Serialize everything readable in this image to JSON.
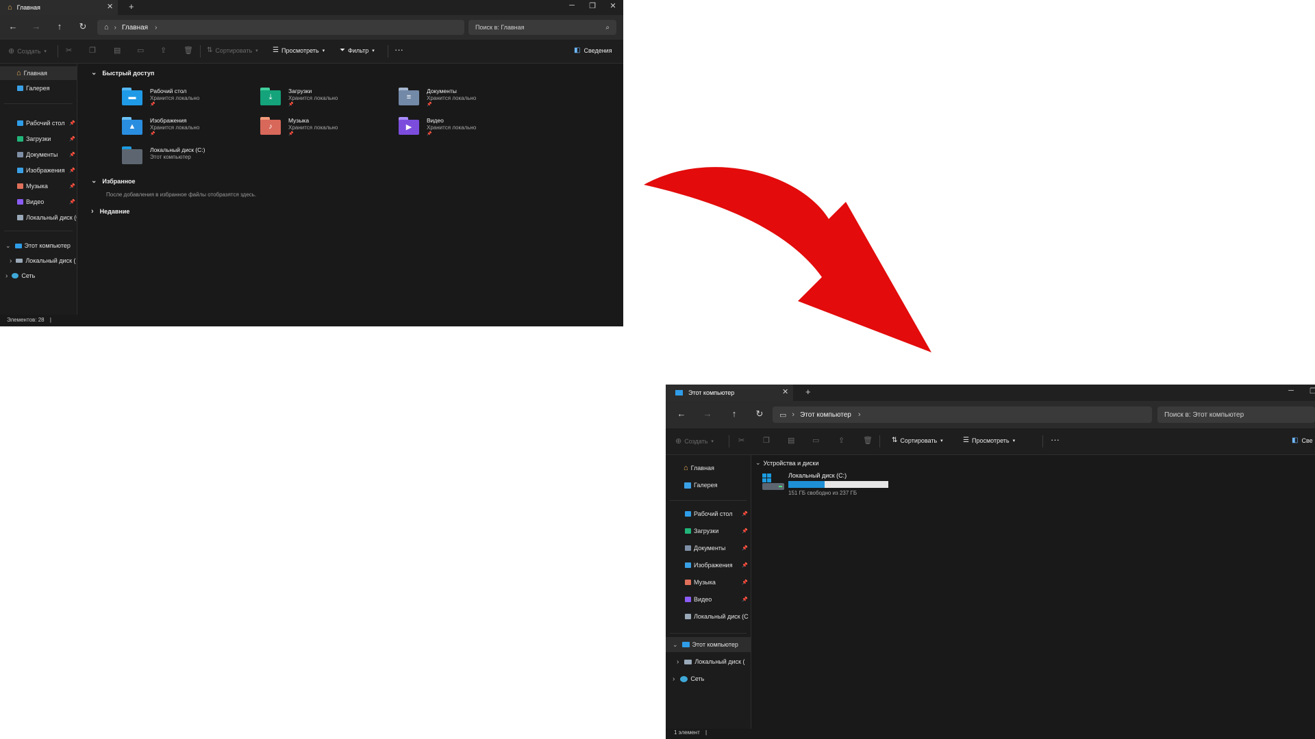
{
  "colors": {
    "accent": "#1e90d6",
    "arrow": "#e30b0b",
    "window_bg": "#191919",
    "sidebar_selected": "#2d2d2d"
  },
  "window1": {
    "tab_title": "Главная",
    "address": "Главная",
    "search_placeholder": "Поиск в: Главная",
    "toolbar": {
      "create": "Создать",
      "sort": "Сортировать",
      "view": "Просмотреть",
      "filter": "Фильтр",
      "details": "Сведения"
    },
    "sidebar": {
      "home": "Главная",
      "gallery": "Галерея",
      "pinned": [
        {
          "label": "Рабочий стол",
          "icon": "desktop-icon"
        },
        {
          "label": "Загрузки",
          "icon": "downloads-icon"
        },
        {
          "label": "Документы",
          "icon": "documents-icon"
        },
        {
          "label": "Изображения",
          "icon": "pictures-icon"
        },
        {
          "label": "Музыка",
          "icon": "music-icon"
        },
        {
          "label": "Видео",
          "icon": "videos-icon"
        },
        {
          "label": "Локальный диск (С",
          "icon": "drive-icon"
        }
      ],
      "this_pc": "Этот компьютер",
      "local_disk": "Локальный диск (",
      "network": "Сеть"
    },
    "sections": {
      "quick_access": "Быстрый доступ",
      "favorites": "Избранное",
      "favorites_hint": "После добавления в избранное файлы отобразятся здесь.",
      "recent": "Недавние"
    },
    "quick_access": [
      {
        "name": "Рабочий стол",
        "sub": "Хранится локально",
        "icon": "desktop-folder-icon"
      },
      {
        "name": "Загрузки",
        "sub": "Хранится локально",
        "icon": "downloads-folder-icon"
      },
      {
        "name": "Документы",
        "sub": "Хранится локально",
        "icon": "documents-folder-icon"
      },
      {
        "name": "Изображения",
        "sub": "Хранится локально",
        "icon": "pictures-folder-icon"
      },
      {
        "name": "Музыка",
        "sub": "Хранится локально",
        "icon": "music-folder-icon"
      },
      {
        "name": "Видео",
        "sub": "Хранится локально",
        "icon": "videos-folder-icon"
      },
      {
        "name": "Локальный диск (C:)",
        "sub": "Этот компьютер",
        "icon": "local-drive-icon"
      }
    ],
    "status": "Элементов: 28"
  },
  "window2": {
    "tab_title": "Этот компьютер",
    "address": "Этот компьютер",
    "search_placeholder": "Поиск в: Этот компьютер",
    "toolbar": {
      "create": "Создать",
      "sort": "Сортировать",
      "view": "Просмотреть",
      "details": "Све"
    },
    "sidebar": {
      "home": "Главная",
      "gallery": "Галерея",
      "pinned": [
        {
          "label": "Рабочий стол",
          "icon": "desktop-icon"
        },
        {
          "label": "Загрузки",
          "icon": "downloads-icon"
        },
        {
          "label": "Документы",
          "icon": "documents-icon"
        },
        {
          "label": "Изображения",
          "icon": "pictures-icon"
        },
        {
          "label": "Музыка",
          "icon": "music-icon"
        },
        {
          "label": "Видео",
          "icon": "videos-icon"
        },
        {
          "label": "Локальный диск (С",
          "icon": "drive-icon"
        }
      ],
      "this_pc": "Этот компьютер",
      "local_disk": "Локальный диск (",
      "network": "Сеть"
    },
    "section": "Устройства и диски",
    "drive": {
      "name": "Локальный диск (C:)",
      "space": "151 ГБ свободно из 237 ГБ",
      "used_fraction": 0.36
    },
    "status": "1 элемент"
  }
}
